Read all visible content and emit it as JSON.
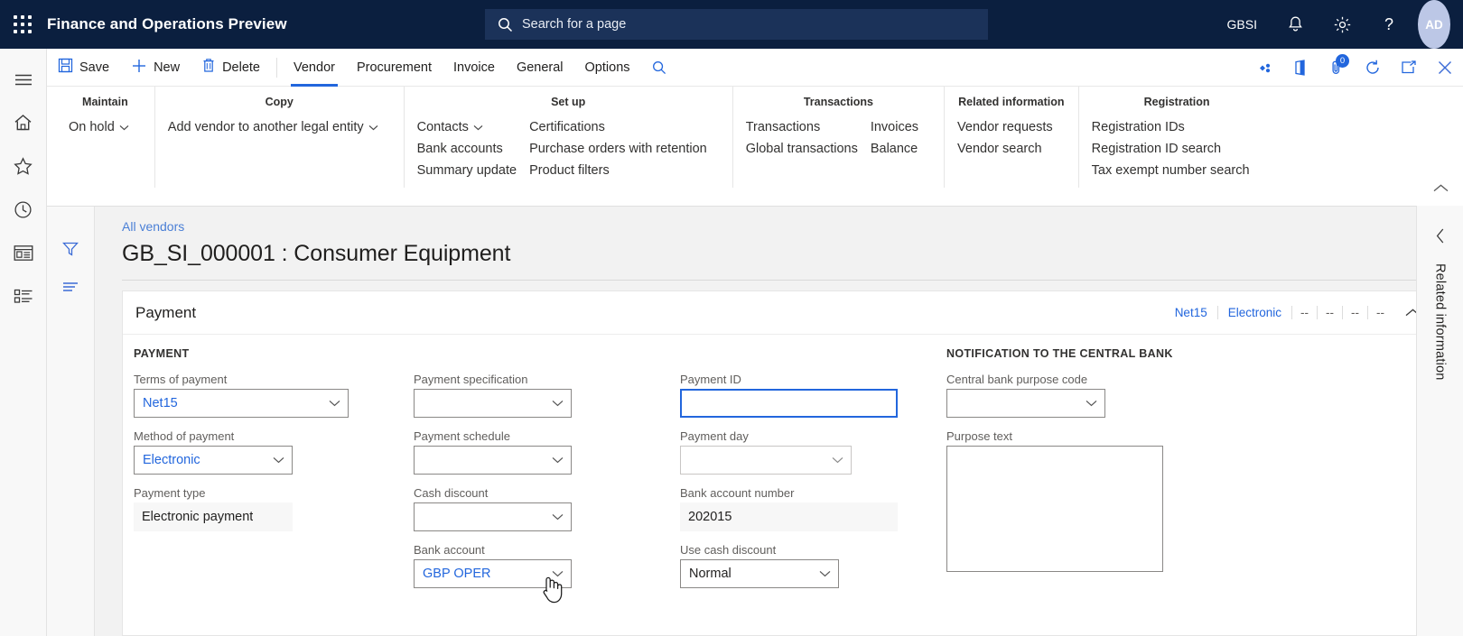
{
  "topbar": {
    "waffle_icon": "waffle-grid-icon",
    "app_title": "Finance and Operations Preview",
    "search": {
      "icon": "search-icon",
      "placeholder": "Search for a page"
    },
    "company": "GBSI",
    "icons": [
      "notifications-bell-icon",
      "settings-gear-icon",
      "help-question-icon"
    ],
    "avatar_initials": "AD"
  },
  "rail": {
    "items": [
      {
        "name": "hamburger-menu-icon",
        "label": "Expand navigation"
      },
      {
        "name": "home-icon",
        "label": "Home"
      },
      {
        "name": "star-favorites-icon",
        "label": "Favorites"
      },
      {
        "name": "clock-recent-icon",
        "label": "Recent"
      },
      {
        "name": "workspaces-icon",
        "label": "Workspaces"
      },
      {
        "name": "modules-list-icon",
        "label": "Modules"
      }
    ]
  },
  "commandbar": {
    "save_label": "Save",
    "new_label": "New",
    "delete_label": "Delete",
    "tabs": [
      {
        "label": "Vendor",
        "active": true
      },
      {
        "label": "Procurement",
        "active": false
      },
      {
        "label": "Invoice",
        "active": false
      },
      {
        "label": "General",
        "active": false
      },
      {
        "label": "Options",
        "active": false
      }
    ],
    "search_icon": "search-icon",
    "right_icons": [
      {
        "name": "power-apps-icon"
      },
      {
        "name": "office-app-icon"
      },
      {
        "name": "attachments-icon",
        "badge": "0"
      },
      {
        "name": "refresh-icon"
      },
      {
        "name": "open-in-new-window-icon"
      },
      {
        "name": "close-icon"
      }
    ]
  },
  "action_pane": {
    "groups": [
      {
        "title": "Maintain",
        "columns": [
          [
            {
              "label": "On hold",
              "caret": true
            }
          ]
        ]
      },
      {
        "title": "Copy",
        "columns": [
          [
            {
              "label": "Add vendor to another legal entity",
              "caret": true
            }
          ]
        ]
      },
      {
        "title": "Set up",
        "columns": [
          [
            {
              "label": "Contacts",
              "caret": true
            },
            {
              "label": "Bank accounts",
              "caret": false
            },
            {
              "label": "Summary update",
              "caret": false
            }
          ],
          [
            {
              "label": "Certifications",
              "caret": false
            },
            {
              "label": "Purchase orders with retention",
              "caret": false
            },
            {
              "label": "Product filters",
              "caret": false
            }
          ]
        ]
      },
      {
        "title": "Transactions",
        "columns": [
          [
            {
              "label": "Transactions",
              "caret": false
            },
            {
              "label": "Global transactions",
              "caret": false
            }
          ],
          [
            {
              "label": "Invoices",
              "caret": false
            },
            {
              "label": "Balance",
              "caret": false
            }
          ]
        ]
      },
      {
        "title": "Related information",
        "columns": [
          [
            {
              "label": "Vendor requests",
              "caret": false
            },
            {
              "label": "Vendor search",
              "caret": false
            }
          ]
        ]
      },
      {
        "title": "Registration",
        "columns": [
          [
            {
              "label": "Registration IDs",
              "caret": false
            },
            {
              "label": "Registration ID search",
              "caret": false
            },
            {
              "label": "Tax exempt number search",
              "caret": false
            }
          ]
        ]
      }
    ],
    "collapse_icon": "chevron-up-icon"
  },
  "filter_rail": {
    "items": [
      {
        "name": "filter-funnel-icon"
      },
      {
        "name": "show-filters-lines-icon"
      }
    ]
  },
  "page": {
    "breadcrumb": "All vendors",
    "title": "GB_SI_000001 : Consumer Equipment"
  },
  "fasttab": {
    "title": "Payment",
    "summary": [
      {
        "text": "Net15",
        "dim": false
      },
      {
        "text": "Electronic",
        "dim": false
      },
      {
        "text": "--",
        "dim": true
      },
      {
        "text": "--",
        "dim": true
      },
      {
        "text": "--",
        "dim": true
      },
      {
        "text": "--",
        "dim": true
      }
    ],
    "chevron_icon": "chevron-up-icon"
  },
  "form": {
    "section_payment": "PAYMENT",
    "section_notification": "NOTIFICATION TO THE CENTRAL BANK",
    "fields": {
      "terms_of_payment": {
        "label": "Terms of payment",
        "value": "Net15"
      },
      "method_of_payment": {
        "label": "Method of payment",
        "value": "Electronic"
      },
      "payment_type": {
        "label": "Payment type",
        "value": "Electronic payment"
      },
      "payment_specification": {
        "label": "Payment specification",
        "value": ""
      },
      "payment_schedule": {
        "label": "Payment schedule",
        "value": ""
      },
      "cash_discount": {
        "label": "Cash discount",
        "value": ""
      },
      "bank_account": {
        "label": "Bank account",
        "value": "GBP OPER"
      },
      "payment_id": {
        "label": "Payment ID",
        "value": ""
      },
      "payment_day": {
        "label": "Payment day",
        "value": ""
      },
      "bank_account_number": {
        "label": "Bank account number",
        "value": "202015"
      },
      "use_cash_discount": {
        "label": "Use cash discount",
        "value": "Normal"
      },
      "central_bank_purpose_code": {
        "label": "Central bank purpose code",
        "value": ""
      },
      "purpose_text": {
        "label": "Purpose text",
        "value": ""
      }
    }
  },
  "related_panel": {
    "collapse_icon": "chevron-left-icon",
    "label": "Related information"
  },
  "colors": {
    "nav_bg": "#0b1f3f",
    "accent_blue": "#2266dd",
    "link_blue": "#4a7fd6",
    "page_bg": "#f2f2f2"
  }
}
